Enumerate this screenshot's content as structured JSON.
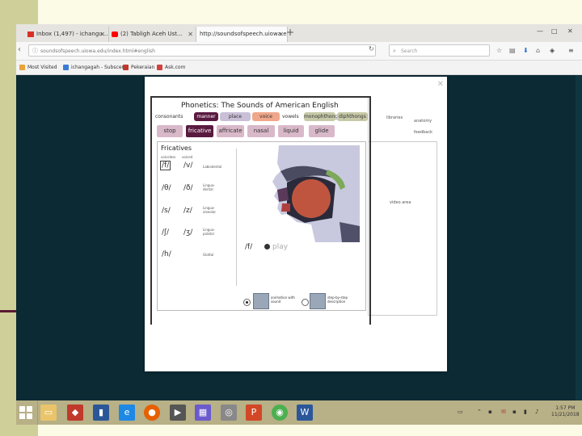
{
  "browser": {
    "tabs": [
      {
        "label": "Inbox (1,497) - ichangu...",
        "icon_color": "#d93025"
      },
      {
        "label": "(2) Tabligh Aceh Ust...",
        "icon_color": "#ff0000"
      },
      {
        "label": "http://soundsofspeech.uiowa.edu/..."
      }
    ],
    "new_tab_symbol": "+",
    "url": "soundsofspeech.uiowa.edu/index.html#english",
    "search_placeholder": "Search",
    "bookmarks": [
      {
        "label": "Most Visited",
        "icon_color": "#e8a33a"
      },
      {
        "label": "ichangagah - Subscene",
        "icon_color": "#3a7bd5"
      },
      {
        "label": "Pekeraian",
        "icon_color": "#c0392b"
      },
      {
        "label": "Ask.com",
        "icon_color": "#d34040"
      }
    ]
  },
  "app": {
    "title": "Phonetics:  The Sounds of American English",
    "categories": [
      {
        "label": "consonants",
        "style": "plain"
      },
      {
        "label": "manner",
        "style": "dark"
      },
      {
        "label": "place",
        "style": "light"
      },
      {
        "label": "voice",
        "style": "salmon"
      },
      {
        "label": "vowels",
        "style": "plain"
      },
      {
        "label": "monophthongs",
        "style": "olive"
      },
      {
        "label": "diphthongs",
        "style": "olive"
      }
    ],
    "right_links": [
      "libraries",
      "anatomy",
      "feedback"
    ],
    "manner_tabs": [
      {
        "label": "stop",
        "selected": false
      },
      {
        "label": "fricative",
        "selected": true
      },
      {
        "label": "affricate",
        "selected": false
      },
      {
        "label": "nasal",
        "selected": false
      },
      {
        "label": "liquid",
        "selected": false
      },
      {
        "label": "glide",
        "selected": false
      }
    ],
    "section_title": "Fricatives",
    "col_voiceless": "voiceless",
    "col_voiced": "voiced",
    "rows": [
      {
        "voiceless": "/f/",
        "voiced": "/v/",
        "place": "Labiodental"
      },
      {
        "voiceless": "/θ/",
        "voiced": "/ð/",
        "place": "Lingua-dental"
      },
      {
        "voiceless": "/s/",
        "voiced": "/z/",
        "place": "Lingua-alveolar"
      },
      {
        "voiceless": "/ʃ/",
        "voiced": "/ʒ/",
        "place": "Lingua-palatal"
      },
      {
        "voiceless": "/h/",
        "voiced": "",
        "place": "Glottal"
      }
    ],
    "current_symbol": "/f/",
    "play_label": "play",
    "option_animation": "animation with sound",
    "option_step": "step-by-step description",
    "video_area": "video area"
  },
  "taskbar": {
    "apps": [
      "file-explorer",
      "store",
      "word-blue",
      "ie",
      "firefox",
      "media",
      "calendar",
      "chrome-like",
      "powerpoint",
      "chrome",
      "word"
    ],
    "clock_time": "1:57 PM",
    "clock_date": "11/21/2018"
  }
}
